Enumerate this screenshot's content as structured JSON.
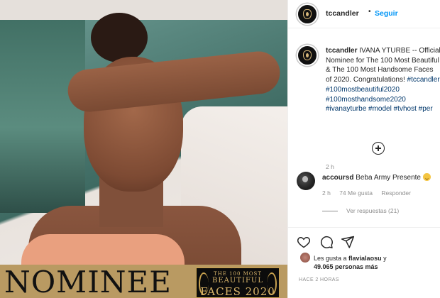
{
  "post": {
    "banner_word": "NOMINEE",
    "badge": {
      "line1": "THE 100 MOST",
      "line2": "BEAUTIFUL",
      "line3": "FACES 2020"
    }
  },
  "header": {
    "username": "tccandler",
    "separator": "•",
    "follow_label": "Seguir"
  },
  "caption": {
    "username": "tccandler",
    "text": "IVANA YTURBE -- Official Nominee for The 100 Most Beautiful & The 100 Most Handsome Faces of 2020. Congratulations! ",
    "hashtags": "#tccandler #100mostbeautiful2020 #100mosthandsome2020 #ivanayturbe #model #tvhost #per",
    "time": "2 h"
  },
  "comment": {
    "username": "accoursd",
    "text": "Beba Army Presente",
    "time": "2 h",
    "likes": "74 Me gusta",
    "reply_label": "Responder",
    "view_replies": "Ver respuestas (21)"
  },
  "likes": {
    "line1_prefix": "Les gusta a ",
    "line1_user": "flavialaosu",
    "line1_suffix": " y",
    "line2_count": "49.065",
    "line2_suffix": " personas más"
  },
  "post_time": "HACE 2 HORAS",
  "icons": {
    "more": "plus-circle-icon",
    "like": "heart-icon",
    "comment": "speech-bubble-icon",
    "share": "paper-plane-icon"
  },
  "colors": {
    "link_blue": "#0095f6",
    "hashtag": "#00376b",
    "muted": "#8e8e8e",
    "banner_gold": "#b99a62"
  }
}
